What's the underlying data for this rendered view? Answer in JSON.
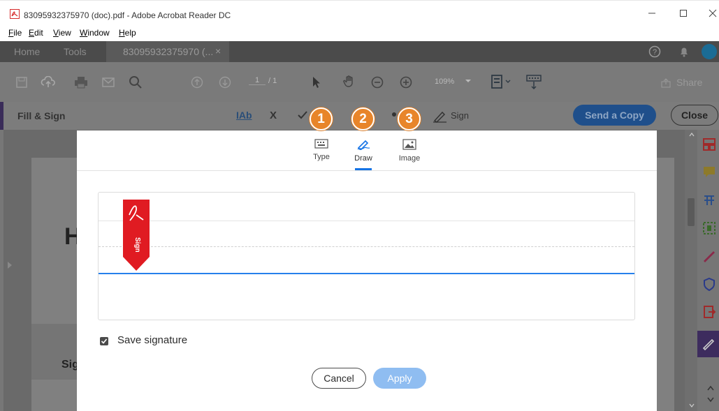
{
  "window": {
    "title": "83095932375970 (doc).pdf - Adobe Acrobat Reader DC"
  },
  "menu": {
    "items": [
      "File",
      "Edit",
      "View",
      "Window",
      "Help"
    ]
  },
  "tabs": {
    "home": "Home",
    "tools": "Tools",
    "document": "83095932375970 (...",
    "document_close": "×"
  },
  "toolbar": {
    "page_current": "1",
    "page_total": "/ 1",
    "zoom": "109%",
    "share": "Share"
  },
  "fill_sign": {
    "title": "Fill & Sign",
    "text_tool": "IAb",
    "cross_tool": "X",
    "sign": "Sign",
    "send_copy": "Send a Copy",
    "close": "Close"
  },
  "document": {
    "heading_fragment": "H",
    "sig_fragment": "Sig"
  },
  "badges": [
    "1",
    "2",
    "3"
  ],
  "dialog": {
    "tabs": [
      {
        "label": "Type",
        "icon": "keyboard-icon"
      },
      {
        "label": "Draw",
        "icon": "pen-icon"
      },
      {
        "label": "Image",
        "icon": "image-icon"
      }
    ],
    "active_tab": "Draw",
    "sign_marker": "Sign",
    "save_signature": "Save signature",
    "save_signature_checked": true,
    "cancel": "Cancel",
    "apply": "Apply"
  },
  "colors": {
    "accent_blue": "#1473e6",
    "badge_orange": "#e8852a",
    "sign_marker_red": "#e01b22",
    "apply_disabled": "#8fbdf1"
  }
}
